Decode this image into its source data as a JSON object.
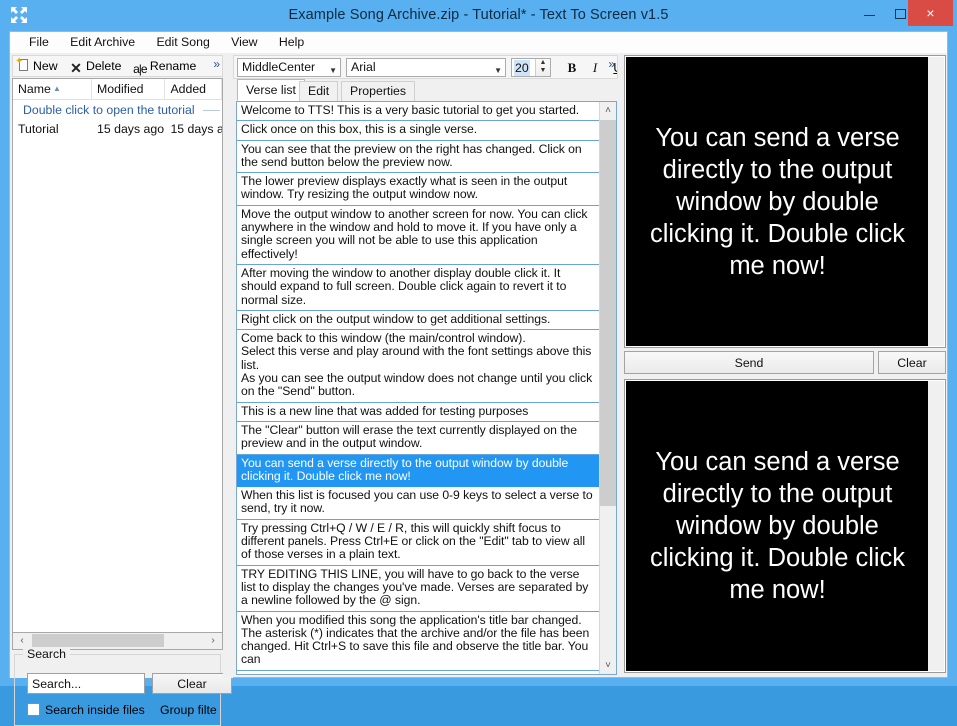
{
  "window": {
    "title": "Example Song Archive.zip - Tutorial* - Text To Screen v1.5",
    "logo_icon": "fullscreen-arrows-icon",
    "minimize_label": "",
    "maximize_label": "",
    "close_label": "×",
    "title_bar_color": "#59b0f0",
    "close_button_color": "#d94c45"
  },
  "menu": {
    "items": [
      {
        "label": "File"
      },
      {
        "label": "Edit Archive"
      },
      {
        "label": "Edit Song"
      },
      {
        "label": "View"
      },
      {
        "label": "Help"
      }
    ]
  },
  "file_toolbar": {
    "new_label": "New",
    "delete_label": "Delete",
    "rename_label": "Rename",
    "delete_glyph": "✕",
    "rename_glyph": "a|e",
    "overflow_glyph": "»"
  },
  "file_list": {
    "columns": [
      {
        "label": "Name",
        "sorted": true,
        "sort_glyph": "▲"
      },
      {
        "label": "Modified",
        "sorted": false
      },
      {
        "label": "Added",
        "sorted": false
      }
    ],
    "group_header": "Double click to open the tutorial",
    "rows": [
      {
        "name": "Tutorial",
        "modified": "15 days ago",
        "added": "15 days a"
      }
    ],
    "hscroll_left_glyph": "‹",
    "hscroll_right_glyph": "›"
  },
  "search": {
    "group_label": "Search",
    "placeholder": "Search...",
    "value": "",
    "clear_label": "Clear",
    "inside_files_label": "Search inside files",
    "inside_files_checked": false,
    "group_filter_label": "Group filte"
  },
  "font_toolbar": {
    "alignment": "MiddleCenter",
    "font_family": "Arial",
    "font_size": "20",
    "bold_label": "B",
    "italic_label": "I",
    "underline_label": "U",
    "overflow_glyph": "»",
    "spin_up_glyph": "▲",
    "spin_down_glyph": "▼",
    "combo_arrow_glyph": "▼"
  },
  "tabs": [
    {
      "label": "Verse list",
      "active": true
    },
    {
      "label": "Edit",
      "active": false
    },
    {
      "label": "Properties",
      "active": false
    }
  ],
  "verse_list": {
    "scroll_up_glyph": "˄",
    "scroll_down_glyph": "˅",
    "items": [
      {
        "text": "Welcome to TTS! This is a very basic tutorial to get you started.",
        "selected": false
      },
      {
        "text": "Click once on this box, this is a single verse.",
        "selected": false
      },
      {
        "text": "You can see that the preview on the right has changed. Click on the send button below the preview now.",
        "selected": false
      },
      {
        "text": "The lower preview displays exactly what is seen in the output window. Try resizing the output window now.",
        "selected": false
      },
      {
        "text": "Move the output window to another screen for now. You can click anywhere in the window and hold to move it. If you have only a single screen you will not be able to use this application effectively!",
        "selected": false
      },
      {
        "text": "After moving the window to another display double click it. It should expand to full screen. Double click again to revert it to normal size.",
        "selected": false
      },
      {
        "text": "Right click on the output window to get additional settings.",
        "selected": false
      },
      {
        "text": "Come back to this window (the main/control window).\nSelect this verse and play around with the font settings above this list.\nAs you can see the output window does not change until you click on the \"Send\" button.",
        "selected": false
      },
      {
        "text": "This is a new line that was added for testing purposes",
        "selected": false
      },
      {
        "text": "The \"Clear\" button will erase the text currently displayed on the preview and in the output window.",
        "selected": false
      },
      {
        "text": "You can send a verse directly to the output window by double clicking it. Double click me now!",
        "selected": true
      },
      {
        "text": "When this list is focused you can use 0-9 keys to select a verse to send, try it now.",
        "selected": false
      },
      {
        "text": "Try pressing Ctrl+Q / W / E / R, this will quickly shift focus to different panels. Press Ctrl+E or click on the \"Edit\" tab to view all of those verses in a plain text.",
        "selected": false
      },
      {
        "text": "TRY EDITING THIS LINE, you will have to go back to the verse list to display the changes you've made. Verses are separated by a newline followed by the @ sign.",
        "selected": false
      },
      {
        "text": "When you modified this song the application's title bar changed. The asterisk (*) indicates that the archive and/or the file has been changed. Hit Ctrl+S to save this file and observe the title bar. You can",
        "selected": false
      }
    ]
  },
  "preview": {
    "top_text": "You can send a verse directly to the output window by double clicking it. Double click me now!",
    "bottom_text": "You can send a verse directly to the output window by double clicking it. Double click me now!",
    "send_label": "Send",
    "clear_label": "Clear",
    "background_color": "#000000",
    "text_color": "#ffffff"
  }
}
